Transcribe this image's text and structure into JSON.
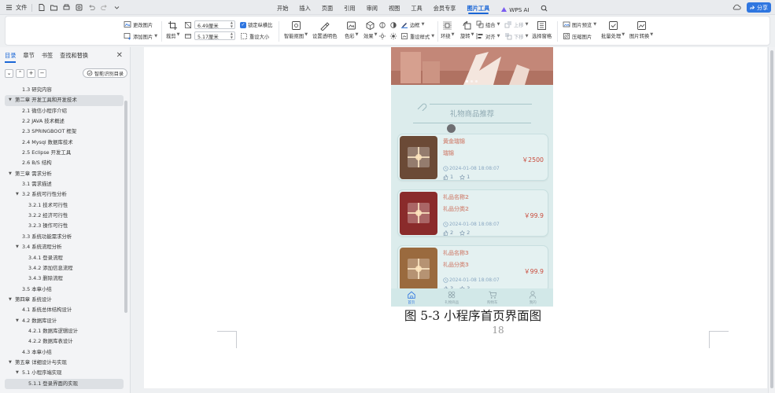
{
  "titlebar": {
    "file_menu": "文件",
    "tabs": [
      {
        "label": "开始"
      },
      {
        "label": "插入"
      },
      {
        "label": "页面"
      },
      {
        "label": "引用"
      },
      {
        "label": "审阅"
      },
      {
        "label": "视图"
      },
      {
        "label": "工具"
      },
      {
        "label": "会员专享"
      },
      {
        "label": "图片工具",
        "active": true
      },
      {
        "label": "WPS AI"
      }
    ],
    "share_label": "分享",
    "accent_color": "#1a66d6"
  },
  "ribbon": {
    "change_image": "更改图片",
    "add_image": "添加图片",
    "crop": "裁剪",
    "height_value": "6.49厘米",
    "width_value": "5.17厘米",
    "lock_ratio": "锁定纵横比",
    "reset_size": "重设大小",
    "lock_ratio_checked": true,
    "smart_crop": "智能抠图",
    "set_transparent": "设置透明色",
    "color": "色彩",
    "effects": "效果",
    "border": "边框",
    "reset_style": "重设样式",
    "wrap": "环绕",
    "rotate": "旋转",
    "group": "组合",
    "align": "对齐",
    "bring_forward": "上移",
    "send_backward": "下移",
    "selection_pane": "选择窗格",
    "image_preview": "图片预览",
    "compress": "压缩图片",
    "batch": "批量处理",
    "convert": "图片转换"
  },
  "panel": {
    "tabs": [
      "目录",
      "章节",
      "书签",
      "查找和替换"
    ],
    "smart_toc": "智能识别目录",
    "toc": [
      {
        "text": "1.3  研究内容",
        "level": 2
      },
      {
        "text": "第二章  开发工具和开发技术",
        "level": 1,
        "expanded": true,
        "highlight": true
      },
      {
        "text": "2.1 微信小程序介绍",
        "level": 2
      },
      {
        "text": "2.2 JAVA 技术概述",
        "level": 2
      },
      {
        "text": "2.3 SPRINGBOOT  框架",
        "level": 2
      },
      {
        "text": "2.4 Mysql 数据库技术",
        "level": 2
      },
      {
        "text": "2.5 Eclipse 开发工具",
        "level": 2
      },
      {
        "text": "2.6 B/S 结构",
        "level": 2
      },
      {
        "text": "第三章  需求分析",
        "level": 1,
        "expanded": true
      },
      {
        "text": "3.1  需求描述",
        "level": 2
      },
      {
        "text": "3.2  系统可行性分析",
        "level": 2,
        "expanded": true
      },
      {
        "text": "3.2.1 技术可行性",
        "level": 3
      },
      {
        "text": "3.2.2  经济可行性",
        "level": 3
      },
      {
        "text": "3.2.3  操作可行性",
        "level": 3
      },
      {
        "text": "3.3  系统功能需求分析",
        "level": 2
      },
      {
        "text": "3.4  系统流程分析",
        "level": 2,
        "expanded": true
      },
      {
        "text": "3.4.1  登录流程",
        "level": 3
      },
      {
        "text": "3.4.2  添加信息流程",
        "level": 3
      },
      {
        "text": "3.4.3  删除流程",
        "level": 3
      },
      {
        "text": "3.5  本章小结",
        "level": 2
      },
      {
        "text": "第四章  系统设计",
        "level": 1,
        "expanded": true
      },
      {
        "text": "4.1  系统总体结构设计",
        "level": 2
      },
      {
        "text": "4.2  数据库设计",
        "level": 2,
        "expanded": true
      },
      {
        "text": "4.2.1  数据库逻辑设计",
        "level": 3
      },
      {
        "text": "4.2.2  数据库表设计",
        "level": 3
      },
      {
        "text": "4.3  本章小结",
        "level": 2
      },
      {
        "text": "第五章  详细设计与实现",
        "level": 1,
        "expanded": true
      },
      {
        "text": "5.1  小程序端实现",
        "level": 2,
        "expanded": true
      },
      {
        "text": "5.1.1  登录界面的实现",
        "level": 3,
        "selected": true
      }
    ]
  },
  "document": {
    "section_title": "礼物商品推荐",
    "products": [
      {
        "name": "黄金瑞锦",
        "category": "瑞锦",
        "price": "￥2500",
        "time": "2024-01-08 18:08:07",
        "likes": "1",
        "favorites": "1",
        "thumb_color": "#6b4a36"
      },
      {
        "name": "礼品名称2",
        "category": "礼品分类2",
        "price": "￥99.9",
        "time": "2024-01-08 18:08:07",
        "likes": "2",
        "favorites": "2",
        "thumb_color": "#8a2b2b"
      },
      {
        "name": "礼品名称3",
        "category": "礼品分类3",
        "price": "￥99.9",
        "time": "2024-01-08 18:08:07",
        "likes": "3",
        "favorites": "3",
        "thumb_color": "#9a6a3e"
      }
    ],
    "tabbar": [
      {
        "label": "首页",
        "icon": "home-icon",
        "active": true
      },
      {
        "label": "礼物商品",
        "icon": "grid-icon"
      },
      {
        "label": "购物车",
        "icon": "cart-icon"
      },
      {
        "label": "我的",
        "icon": "user-icon"
      }
    ],
    "caption": "图 5-3  小程序首页界面图",
    "page_number": "18"
  }
}
